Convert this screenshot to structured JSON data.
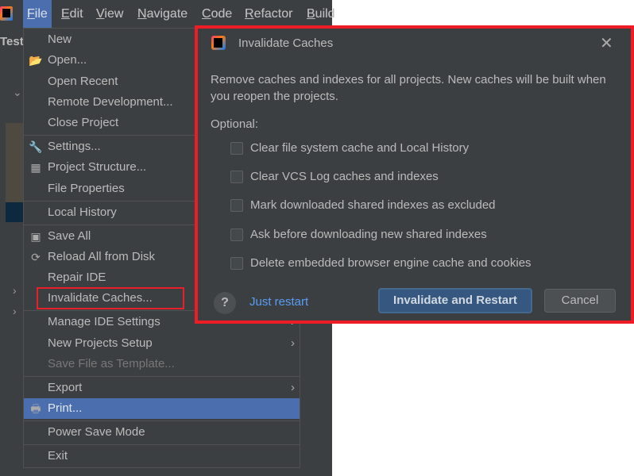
{
  "menubar": {
    "items": [
      {
        "label": "File",
        "mnemonic": "F",
        "rest": "ile"
      },
      {
        "label": "Edit",
        "mnemonic": "E",
        "rest": "dit"
      },
      {
        "label": "View",
        "mnemonic": "V",
        "rest": "iew"
      },
      {
        "label": "Navigate",
        "mnemonic": "N",
        "rest": "avigate"
      },
      {
        "label": "Code",
        "mnemonic": "C",
        "rest": "ode"
      },
      {
        "label": "Refactor",
        "mnemonic": "R",
        "rest": "efactor"
      },
      {
        "label": "Build",
        "mnemonic": "B",
        "rest": "uild"
      }
    ],
    "active": "File"
  },
  "project_tab": "TestI",
  "file_menu": {
    "items": [
      {
        "label": "New",
        "icon": ""
      },
      {
        "label": "Open...",
        "icon": "folder-open-icon"
      },
      {
        "label": "Open Recent",
        "icon": ""
      },
      {
        "label": "Remote Development...",
        "icon": ""
      },
      {
        "label": "Close Project",
        "icon": ""
      },
      {
        "label": "Settings...",
        "icon": "wrench-icon"
      },
      {
        "label": "Project Structure...",
        "icon": "project-structure-icon"
      },
      {
        "label": "File Properties",
        "icon": ""
      },
      {
        "label": "Local History",
        "icon": ""
      },
      {
        "label": "Save All",
        "icon": "save-icon"
      },
      {
        "label": "Reload All from Disk",
        "icon": "reload-icon"
      },
      {
        "label": "Repair IDE",
        "icon": ""
      },
      {
        "label": "Invalidate Caches...",
        "icon": "",
        "outlined": true
      },
      {
        "label": "Manage IDE Settings",
        "icon": "",
        "submenu": true
      },
      {
        "label": "New Projects Setup",
        "icon": "",
        "submenu": true
      },
      {
        "label": "Save File as Template...",
        "icon": "",
        "disabled": true
      },
      {
        "label": "Export",
        "icon": "",
        "submenu": true
      },
      {
        "label": "Print...",
        "icon": "printer-icon",
        "highlighted": true
      },
      {
        "label": "Power Save Mode",
        "icon": ""
      },
      {
        "label": "Exit",
        "icon": ""
      }
    ]
  },
  "dialog": {
    "title": "Invalidate Caches",
    "description": "Remove caches and indexes for all projects. New caches will be built when you reopen the projects.",
    "optional_label": "Optional:",
    "options": [
      {
        "label": "Clear file system cache and Local History",
        "checked": false
      },
      {
        "label": "Clear VCS Log caches and indexes",
        "checked": false
      },
      {
        "label": "Mark downloaded shared indexes as excluded",
        "checked": false
      },
      {
        "label": "Ask before downloading new shared indexes",
        "checked": false
      },
      {
        "label": "Delete embedded browser engine cache and cookies",
        "checked": false
      }
    ],
    "help_label": "?",
    "just_restart": "Just restart",
    "primary_button": "Invalidate and Restart",
    "cancel_button": "Cancel"
  },
  "colors": {
    "highlight": "#4b6eaf",
    "annotation_red": "#ee1c25",
    "link": "#589df6",
    "background": "#3c3f41"
  }
}
